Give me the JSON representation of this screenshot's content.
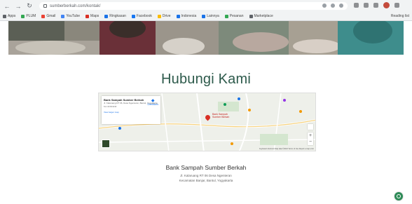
{
  "browser": {
    "url": "sumberberkah.com/kontak/",
    "bookmarks": [
      "Apps",
      "PLUM",
      "Gmail",
      "YouTube",
      "Maps",
      "Ringkasan",
      "Facebook",
      "Drive",
      "Indonesia",
      "Lainnya",
      "Pesanan",
      "Marketplace"
    ],
    "reading_list": "Reading list"
  },
  "page": {
    "heading": "Hubungi Kami",
    "org_name": "Bank Sampah Sumber Berkah",
    "address_line1": "Jl. Kalaruang RT 06 Desa Ngenteran",
    "address_line2": "Kecamatan Banjar, Bantul, Yogyakarta"
  },
  "map": {
    "place_title": "Bank Sampah Sumber Berkah",
    "place_address": "Jl. Kalaruang RT 06, Desa Ngenteran, Bantul, Yogyakarta",
    "rating": "5.0 ★★★★★",
    "larger_map": "View larger map",
    "directions": "Directions",
    "pin_label": "Bank Sampah Sumber Berkah",
    "footer": "Keyboard shortcuts  Map data ©2024  Terms of Use  Report a map error"
  },
  "colors": {
    "heading": "#2d5a4b",
    "fab": "#2e8b57"
  }
}
